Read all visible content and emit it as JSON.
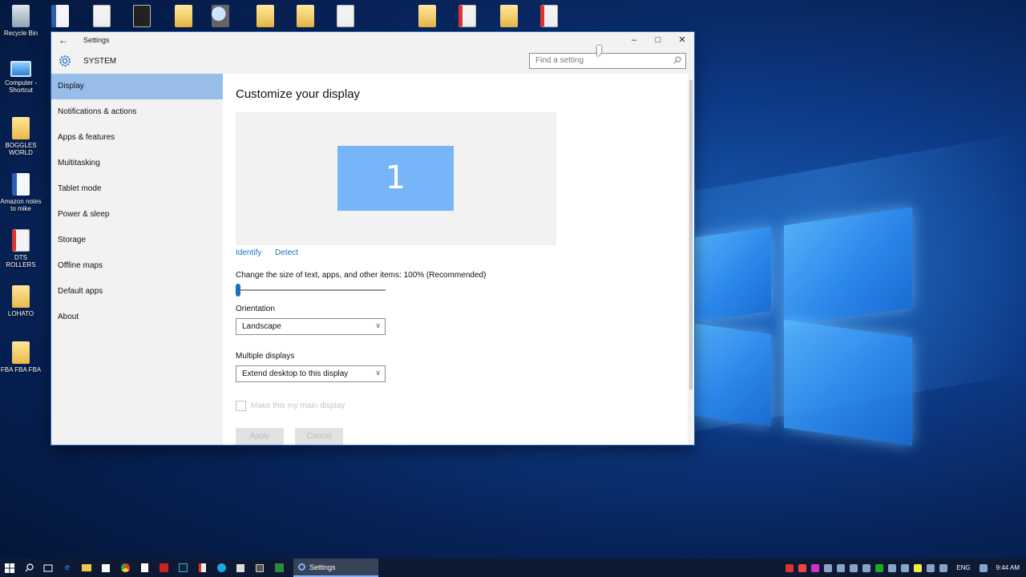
{
  "desktop": {
    "icons_left": [
      {
        "label": "Recycle Bin",
        "icon": "recycle-bin-icon"
      },
      {
        "label": "Computer - Shortcut",
        "icon": "computer-shortcut-icon"
      },
      {
        "label": "BOGGLES WORLD",
        "icon": "document-icon"
      },
      {
        "label": "Amazon notes to mike",
        "icon": "word-document-icon"
      },
      {
        "label": "DTS ROLLERS",
        "icon": "pdf-document-icon"
      },
      {
        "label": "LOHATO",
        "icon": "folder-icon"
      },
      {
        "label": "FBA FBA FBA",
        "icon": "document-icon"
      }
    ]
  },
  "window": {
    "title": "Settings",
    "back_glyph": "←",
    "minimize_glyph": "–",
    "maximize_glyph": "□",
    "close_glyph": "✕",
    "header_title": "SYSTEM",
    "search_placeholder": "Find a setting"
  },
  "sidebar": {
    "items": [
      {
        "label": "Display",
        "active": true
      },
      {
        "label": "Notifications & actions"
      },
      {
        "label": "Apps & features"
      },
      {
        "label": "Multitasking"
      },
      {
        "label": "Tablet mode"
      },
      {
        "label": "Power & sleep"
      },
      {
        "label": "Storage"
      },
      {
        "label": "Offline maps"
      },
      {
        "label": "Default apps"
      },
      {
        "label": "About"
      }
    ]
  },
  "content": {
    "title": "Customize your display",
    "monitor_number": "1",
    "identify_link": "Identify",
    "detect_link": "Detect",
    "size_label": "Change the size of text, apps, and other items: 100% (Recommended)",
    "size_value_percent": 100,
    "orientation_label": "Orientation",
    "orientation_value": "Landscape",
    "multiple_displays_label": "Multiple displays",
    "multiple_displays_value": "Extend desktop to this display",
    "main_display_checkbox": "Make this my main display",
    "apply_button": "Apply",
    "cancel_button": "Cancel"
  },
  "taskbar": {
    "active_app": "Settings",
    "language": "ENG",
    "time": "9:44 AM"
  },
  "colors": {
    "accent": "#1a6fc2",
    "nav_active": "#97bde8",
    "monitor": "#75b5f8",
    "taskbar": "#0e1a33"
  }
}
